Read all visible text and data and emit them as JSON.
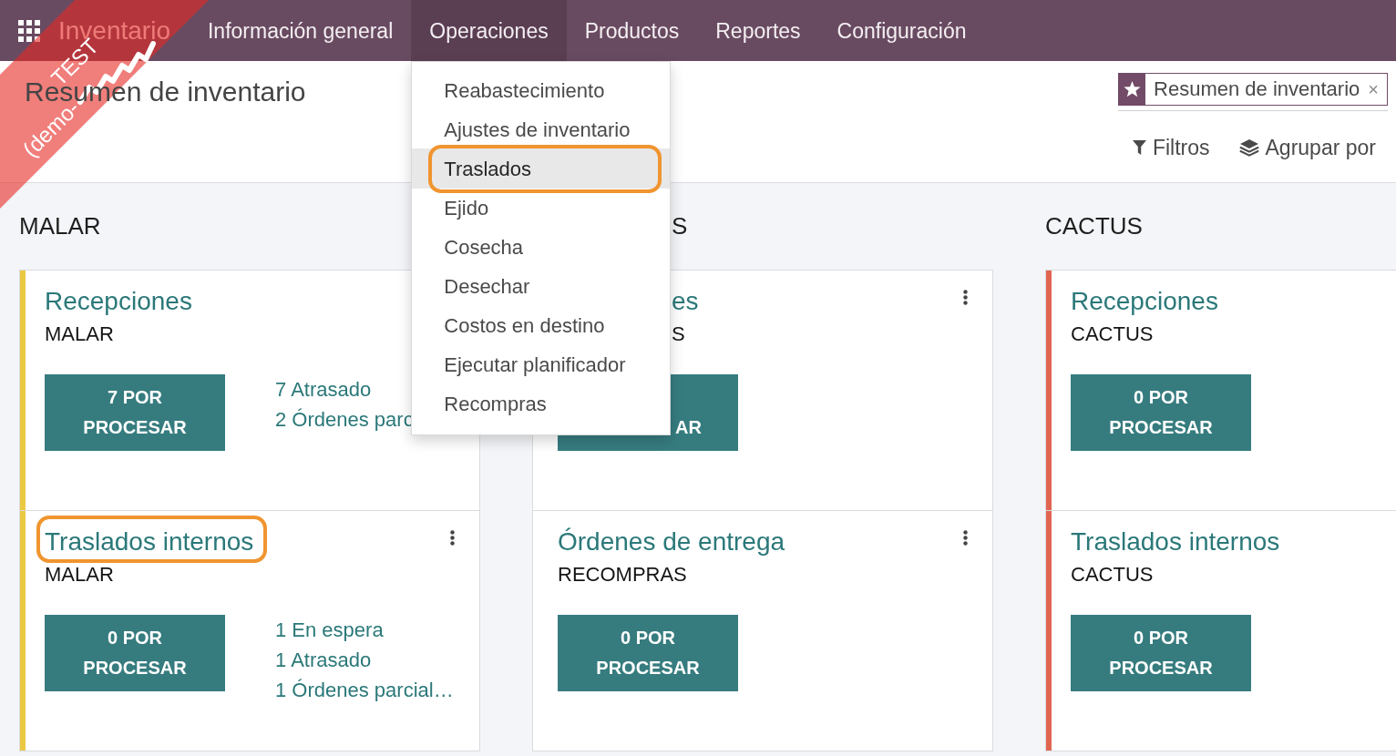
{
  "ribbon": {
    "lines": [
      "TEST",
      "(demo-"
    ],
    "redacted": true
  },
  "navbar": {
    "brand": "Inventario",
    "menu": [
      {
        "label": "Información general",
        "selected": false
      },
      {
        "label": "Operaciones",
        "selected": true
      },
      {
        "label": "Productos",
        "selected": false
      },
      {
        "label": "Reportes",
        "selected": false
      },
      {
        "label": "Configuración",
        "selected": false
      }
    ]
  },
  "dropdown": {
    "items": [
      {
        "label": "Reabastecimiento",
        "selected": false,
        "highlighted": false
      },
      {
        "label": "Ajustes de inventario",
        "selected": false,
        "highlighted": false
      },
      {
        "label": "Traslados",
        "selected": true,
        "highlighted": true
      },
      {
        "label": "Ejido",
        "selected": false,
        "highlighted": false
      },
      {
        "label": "Cosecha",
        "selected": false,
        "highlighted": false
      },
      {
        "label": "Desechar",
        "selected": false,
        "highlighted": false
      },
      {
        "label": "Costos en destino",
        "selected": false,
        "highlighted": false
      },
      {
        "label": "Ejecutar planificador",
        "selected": false,
        "highlighted": false
      },
      {
        "label": "Recompras",
        "selected": false,
        "highlighted": false
      }
    ]
  },
  "control_panel": {
    "title": "Resumen de inventario",
    "search": {
      "facets": [
        {
          "label": "Resumen de inventario",
          "remove": "×"
        }
      ]
    },
    "actions": [
      {
        "kind": "filter",
        "label": "Filtros"
      },
      {
        "kind": "group",
        "label": "Agrupar por"
      }
    ]
  },
  "columns": [
    {
      "header": {
        "text": "MALAR",
        "kind": "full"
      },
      "color": "#ebc843",
      "cards": [
        {
          "kind": "full",
          "title": "Recepciones",
          "subtitle": "MALAR",
          "button": "7 POR PROCESAR",
          "stats": [
            "7 Atrasado",
            "2 Órdenes parc"
          ],
          "menu": false,
          "highlighted": false
        },
        {
          "kind": "full",
          "title": "Traslados internos",
          "subtitle": "MALAR",
          "button": "0 POR PROCESAR",
          "stats": [
            "1 En espera",
            "1 Atrasado",
            "1 Órdenes parcial…"
          ],
          "menu": true,
          "highlighted": true
        }
      ]
    },
    {
      "header": {
        "text": "S",
        "kind": "covered"
      },
      "cards": [
        {
          "kind": "covered",
          "title": "es",
          "subtitle": "S",
          "button": "AR",
          "menu": true,
          "highlighted": false
        },
        {
          "kind": "full",
          "title": "Órdenes de entrega",
          "subtitle": "RECOMPRAS",
          "button": "0 POR PROCESAR",
          "menu": true,
          "highlighted": false
        }
      ]
    },
    {
      "header": {
        "text": "CACTUS",
        "kind": "full"
      },
      "color": "#e0654f",
      "cards": [
        {
          "kind": "full",
          "title": "Recepciones",
          "subtitle": "CACTUS",
          "button": "0 POR PROCESAR",
          "menu": false,
          "highlighted": false
        },
        {
          "kind": "full",
          "title": "Traslados internos",
          "subtitle": "CACTUS",
          "button": "0 POR PROCESAR",
          "menu": false,
          "highlighted": false
        }
      ]
    }
  ]
}
